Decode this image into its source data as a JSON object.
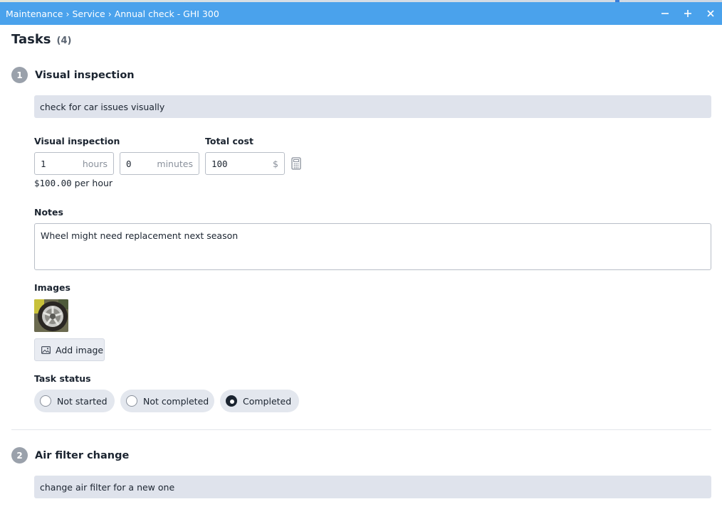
{
  "window": {
    "breadcrumb": [
      "Maintenance",
      "Service",
      "Annual check - GHI 300"
    ],
    "separator": "›",
    "controls": [
      "minimize-icon",
      "maximize-icon",
      "close-icon"
    ]
  },
  "tasks": {
    "heading": "Tasks",
    "count": "(4)"
  },
  "task1": {
    "number": "1",
    "title": "Visual inspection",
    "description": "check for car issues visually",
    "time_label": "Visual inspection",
    "hours_value": "1",
    "hours_unit": "hours",
    "minutes_value": "0",
    "minutes_unit": "minutes",
    "cost_label": "Total cost",
    "cost_value": "100",
    "cost_unit": "$",
    "rate_amount": "$100.00",
    "rate_suffix": "per hour",
    "notes_label": "Notes",
    "notes_value": "Wheel might need replacement next season",
    "images_label": "Images",
    "add_image_label": "Add image",
    "status_label": "Task status",
    "status_options": [
      "Not started",
      "Not completed",
      "Completed"
    ],
    "status_selected": "Completed"
  },
  "task2": {
    "number": "2",
    "title": "Air filter change",
    "description": "change air filter for a new one"
  },
  "colors": {
    "titlebar": "#4aa2ec",
    "description_bg": "#dfe3ec",
    "badge": "#9aa1ab"
  }
}
